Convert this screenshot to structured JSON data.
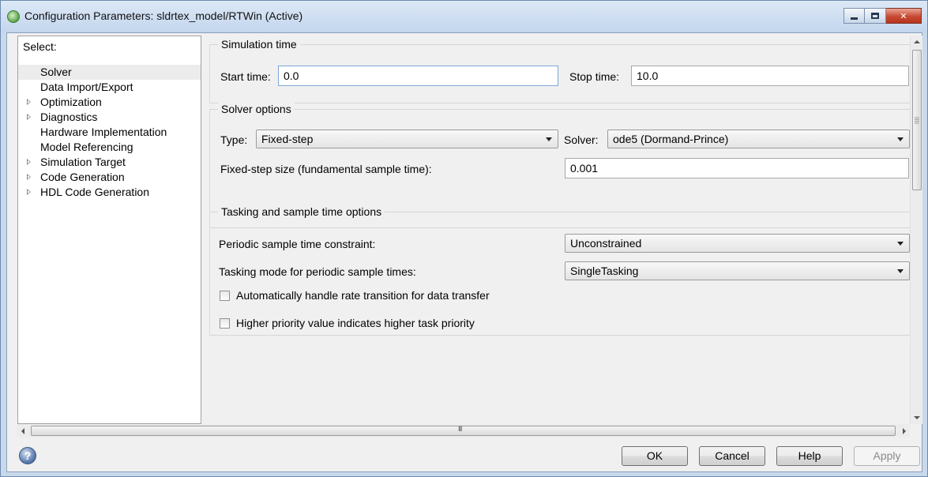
{
  "window": {
    "title": "Configuration Parameters: sldrtex_model/RTWin (Active)"
  },
  "tree": {
    "header": "Select:",
    "items": [
      {
        "label": "Solver",
        "expandable": false,
        "selected": true
      },
      {
        "label": "Data Import/Export",
        "expandable": false,
        "selected": false
      },
      {
        "label": "Optimization",
        "expandable": true,
        "selected": false
      },
      {
        "label": "Diagnostics",
        "expandable": true,
        "selected": false
      },
      {
        "label": "Hardware Implementation",
        "expandable": false,
        "selected": false
      },
      {
        "label": "Model Referencing",
        "expandable": false,
        "selected": false
      },
      {
        "label": "Simulation Target",
        "expandable": true,
        "selected": false
      },
      {
        "label": "Code Generation",
        "expandable": true,
        "selected": false
      },
      {
        "label": "HDL Code Generation",
        "expandable": true,
        "selected": false
      }
    ]
  },
  "simulation_time": {
    "title": "Simulation time",
    "start_label": "Start time:",
    "start_value": "0.0",
    "stop_label": "Stop time:",
    "stop_value": "10.0"
  },
  "solver_options": {
    "title": "Solver options",
    "type_label": "Type:",
    "type_value": "Fixed-step",
    "solver_label": "Solver:",
    "solver_value": "ode5 (Dormand-Prince)",
    "step_label": "Fixed-step size (fundamental sample time):",
    "step_value": "0.001"
  },
  "tasking": {
    "title": "Tasking and sample time options",
    "periodic_label": "Periodic sample time constraint:",
    "periodic_value": "Unconstrained",
    "mode_label": "Tasking mode for periodic sample times:",
    "mode_value": "SingleTasking",
    "auto_rate_label": "Automatically handle rate transition for data transfer",
    "auto_rate_checked": false,
    "priority_label": "Higher priority value indicates higher task priority",
    "priority_checked": false
  },
  "scrollbar": {
    "grip": "III"
  },
  "buttons": {
    "ok": "OK",
    "cancel": "Cancel",
    "help": "Help",
    "apply": "Apply",
    "help_icon": "?"
  },
  "icons": {
    "app": "simulink-config-icon",
    "help": "help-icon"
  },
  "colors": {
    "titlebar": "#c3d6ee",
    "close_button": "#c74a33",
    "selected_row": "#ececec"
  }
}
